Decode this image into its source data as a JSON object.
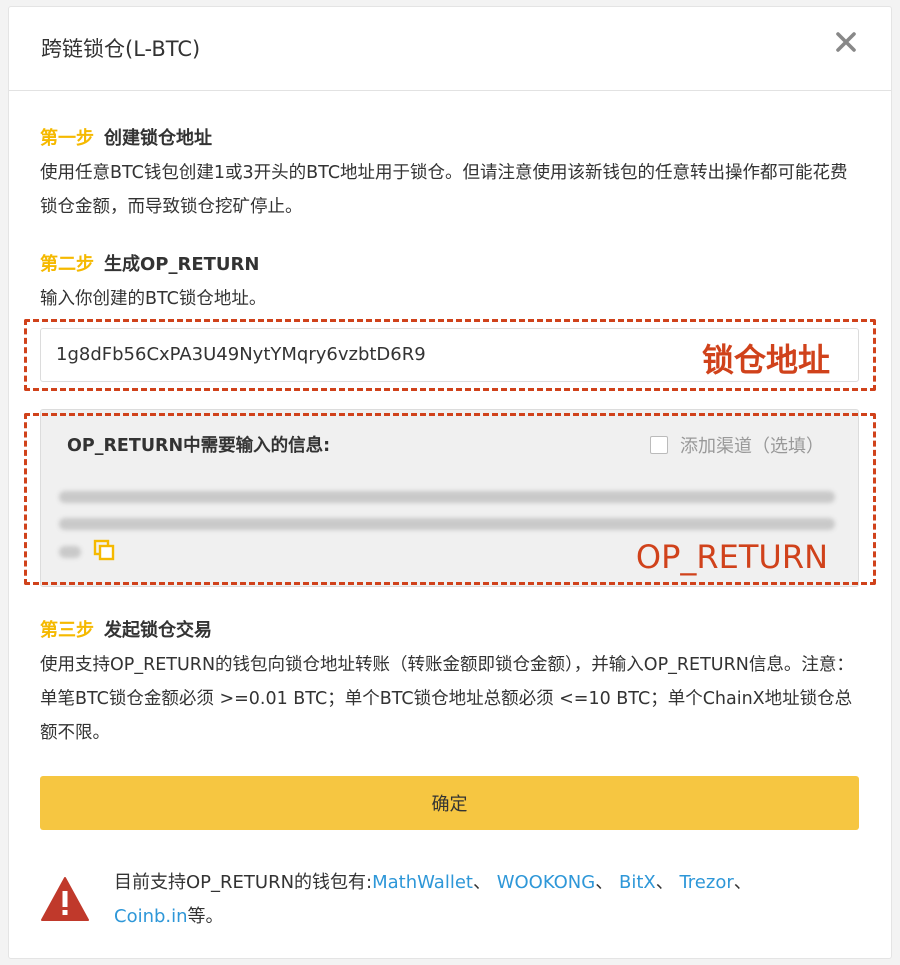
{
  "modal": {
    "title": "跨链锁仓(L-BTC)"
  },
  "step1": {
    "label": "第一步",
    "title": "创建锁仓地址",
    "desc": "使用任意BTC钱包创建1或3开头的BTC地址用于锁仓。但请注意使用该新钱包的任意转出操作都可能花费锁仓金额，而导致锁仓挖矿停止。"
  },
  "step2": {
    "label": "第二步",
    "title": "生成OP_RETURN",
    "desc": "输入你创建的BTC锁仓地址。",
    "address_value": "1g8dFb56CxPA3U49NytYMqry6vzbtD6R9",
    "address_annotation": "锁仓地址"
  },
  "op_return": {
    "title": "OP_RETURN中需要输入的信息:",
    "channel_label": "添加渠道（选填）",
    "channel_checked": false,
    "annotation": "OP_RETURN"
  },
  "step3": {
    "label": "第三步",
    "title": "发起锁仓交易",
    "desc": "使用支持OP_RETURN的钱包向锁仓地址转账（转账金额即锁仓金额），并输入OP_RETURN信息。注意：单笔BTC锁仓金额必须 >=0.01 BTC；单个BTC锁仓地址总额必须 <=10 BTC；单个ChainX地址锁仓总额不限。"
  },
  "confirm_label": "确定",
  "notice": {
    "prefix": "目前支持OP_RETURN的钱包有:",
    "wallets": [
      "MathWallet",
      "WOOKONG",
      "BitX",
      "Trezor",
      "Coinb.in"
    ],
    "separator": "、 ",
    "suffix": "等。"
  },
  "colors": {
    "accent": "#f5b900",
    "button": "#f6c641",
    "annotation": "#d0421b",
    "link": "#2e97d8",
    "warning": "#c0392b"
  },
  "icons": [
    "close-icon",
    "copy-icon",
    "warning-icon"
  ]
}
